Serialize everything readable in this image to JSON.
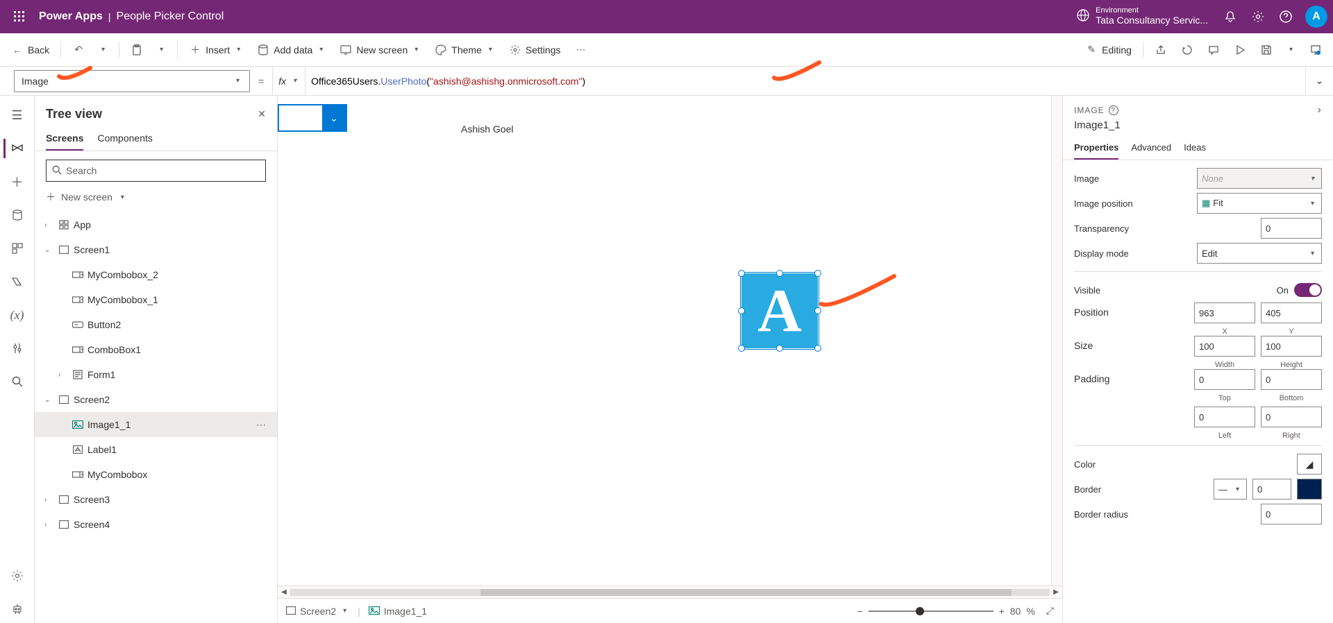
{
  "topbar": {
    "appname": "Power Apps",
    "project": "People Picker Control",
    "env_label": "Environment",
    "env_name": "Tata Consultancy Servic...",
    "avatar_initial": "A"
  },
  "cmdbar": {
    "back": "Back",
    "insert": "Insert",
    "add_data": "Add data",
    "new_screen": "New screen",
    "theme": "Theme",
    "settings": "Settings",
    "editing": "Editing"
  },
  "formula": {
    "property": "Image",
    "eq": "=",
    "fx": "fx",
    "f_prefix": "Office365Users.",
    "f_method": "UserPhoto",
    "f_open": "(",
    "f_string": "\"ashish@ashishg.onmicrosoft.com\"",
    "f_close": ")"
  },
  "treeview": {
    "title": "Tree view",
    "tab_screens": "Screens",
    "tab_components": "Components",
    "search_placeholder": "Search",
    "new_screen": "New screen",
    "items": {
      "app": "App",
      "screen1": "Screen1",
      "combo2": "MyCombobox_2",
      "combo1": "MyCombobox_1",
      "button2": "Button2",
      "combobox1": "ComboBox1",
      "form1": "Form1",
      "screen2": "Screen2",
      "image1_1": "Image1_1",
      "label1": "Label1",
      "mycombobox": "MyCombobox",
      "screen3": "Screen3",
      "screen4": "Screen4"
    }
  },
  "canvas": {
    "label_text": "Ashish Goel",
    "selected_initial": "A"
  },
  "breadcrumb": {
    "screen": "Screen2",
    "control": "Image1_1",
    "zoom_pct": "80",
    "zoom_unit": "%"
  },
  "props": {
    "header_type": "IMAGE",
    "name": "Image1_1",
    "tab_properties": "Properties",
    "tab_advanced": "Advanced",
    "tab_ideas": "Ideas",
    "image_label": "Image",
    "image_value": "None",
    "image_position_label": "Image position",
    "image_position_value": "Fit",
    "transparency_label": "Transparency",
    "transparency_value": "0",
    "display_mode_label": "Display mode",
    "display_mode_value": "Edit",
    "visible_label": "Visible",
    "visible_value": "On",
    "position_label": "Position",
    "position_x": "963",
    "position_y": "405",
    "x_sub": "X",
    "y_sub": "Y",
    "size_label": "Size",
    "size_w": "100",
    "size_h": "100",
    "w_sub": "Width",
    "h_sub": "Height",
    "padding_label": "Padding",
    "pad_top": "0",
    "pad_bottom": "0",
    "pad_left": "0",
    "pad_right": "0",
    "top_sub": "Top",
    "bottom_sub": "Bottom",
    "left_sub": "Left",
    "right_sub": "Right",
    "color_label": "Color",
    "border_label": "Border",
    "border_value": "0",
    "border_radius_label": "Border radius",
    "border_radius_value": "0"
  }
}
